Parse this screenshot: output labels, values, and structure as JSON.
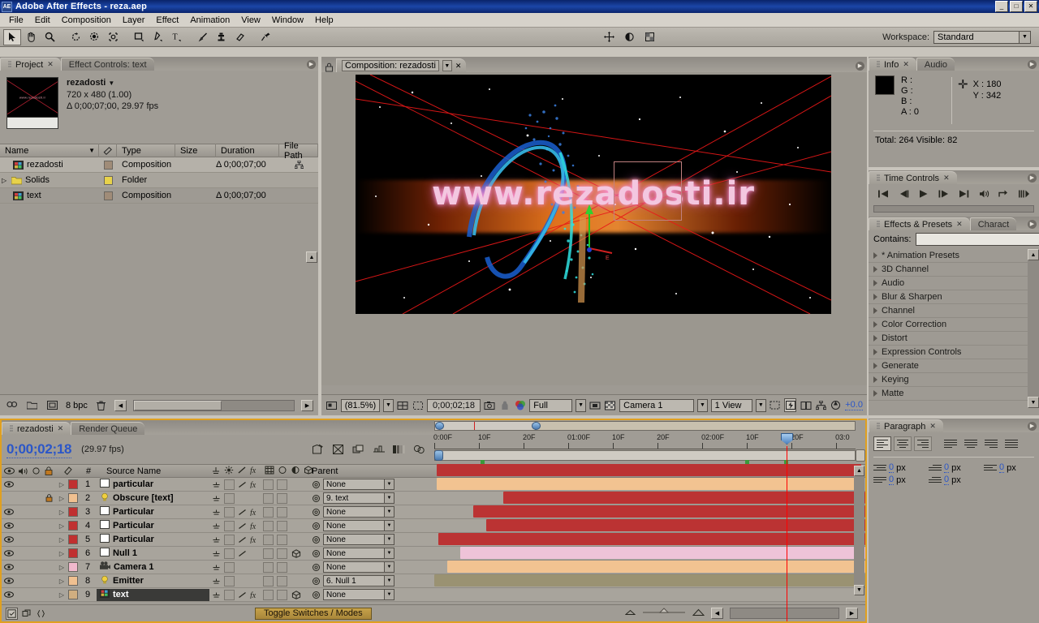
{
  "window": {
    "title": "Adobe After Effects - reza.aep",
    "app_icon": "AE",
    "minimize": "_",
    "maximize": "□",
    "close": "✕"
  },
  "menubar": {
    "items": [
      "File",
      "Edit",
      "Composition",
      "Layer",
      "Effect",
      "Animation",
      "View",
      "Window",
      "Help"
    ]
  },
  "toolbar": {
    "tools": [
      {
        "name": "selection-tool",
        "glyph": "➤",
        "selected": true
      },
      {
        "name": "hand-tool",
        "glyph": "✋",
        "selected": false
      },
      {
        "name": "zoom-tool",
        "glyph": "🔍",
        "selected": false
      },
      {
        "name": "rotation-tool",
        "glyph": "↻",
        "selected": false
      },
      {
        "name": "orbit-camera-tool",
        "glyph": "◕",
        "selected": false
      },
      {
        "name": "pan-behind-tool",
        "glyph": "✣",
        "selected": false
      },
      {
        "name": "shape-tool",
        "glyph": "▭",
        "selected": false
      },
      {
        "name": "pen-tool",
        "glyph": "✒",
        "selected": false
      },
      {
        "name": "type-tool",
        "glyph": "T",
        "selected": false
      },
      {
        "name": "brush-tool",
        "glyph": "🖌",
        "selected": false
      },
      {
        "name": "clone-stamp-tool",
        "glyph": "⚗",
        "selected": false
      },
      {
        "name": "eraser-tool",
        "glyph": "▰",
        "selected": false
      },
      {
        "name": "puppet-pin-tool",
        "glyph": "📌",
        "selected": false
      }
    ],
    "right_icons": [
      {
        "name": "move-anchor-icon",
        "glyph": "✥"
      },
      {
        "name": "mask-opacity-icon",
        "glyph": "◓"
      },
      {
        "name": "toggle-transparency-icon",
        "glyph": "▨"
      }
    ],
    "workspace_label": "Workspace:",
    "workspace_value": "Standard"
  },
  "project": {
    "tabs": [
      {
        "label": "Project",
        "active": true,
        "closable": true
      },
      {
        "label": "Effect Controls: text",
        "active": false,
        "closable": false
      }
    ],
    "selected_item": {
      "name": "rezadosti",
      "dimensions": "720 x 480 (1.00)",
      "duration_fps": "Δ 0;00;07;00, 29.97 fps",
      "thumb_text": "www.rezadosti.ir"
    },
    "columns": [
      "Name",
      "",
      "Type",
      "Size",
      "Duration",
      "File Path"
    ],
    "rows": [
      {
        "name": "rezadosti",
        "icon": "composition-icon",
        "swatch": "#a08c78",
        "type": "Composition",
        "size": "",
        "duration": "Δ 0;00;07;00",
        "selected": true
      },
      {
        "name": "Solids",
        "icon": "folder-icon",
        "swatch": "#e8d24a",
        "type": "Folder",
        "size": "",
        "duration": "",
        "selected": false
      },
      {
        "name": "text",
        "icon": "composition-icon",
        "swatch": "#a08c78",
        "type": "Composition",
        "size": "",
        "duration": "Δ 0;00;07;00",
        "selected": false
      }
    ],
    "footer": {
      "bit_depth": "8 bpc",
      "icons": [
        "search-icon",
        "new-folder-icon",
        "new-composition-icon",
        "delete-icon"
      ]
    }
  },
  "composition": {
    "tab_label": "Composition: rezadosti",
    "comp_text": "www.rezadosti.ir",
    "footer": {
      "magnification": "(81.5%)",
      "current_time": "0;00;02;18",
      "resolution": "Full",
      "view_camera": "Camera 1",
      "view_layout": "1 View",
      "exposure": "+0.0",
      "icons": [
        "always-preview-icon",
        "take-snapshot-icon",
        "show-snapshot-icon",
        "show-channel-icon",
        "region-of-interest-icon",
        "transparency-grid-icon",
        "toggle-mask-icon",
        "timecode-icon",
        "grid-guides-icon",
        "3d-view-icon",
        "pixel-aspect-icon",
        "fast-previews-icon",
        "comp-flowchart-icon",
        "reset-exposure-icon"
      ]
    }
  },
  "info": {
    "tabs": [
      {
        "label": "Info",
        "active": true
      },
      {
        "label": "Audio",
        "active": false
      }
    ],
    "channels": [
      {
        "label": "R :",
        "value": ""
      },
      {
        "label": "G :",
        "value": ""
      },
      {
        "label": "B :",
        "value": ""
      },
      {
        "label": "A :",
        "value": "0"
      }
    ],
    "coords": [
      {
        "label": "X :",
        "value": "180"
      },
      {
        "label": "Y :",
        "value": "342"
      }
    ],
    "status": "Total: 264   Visible: 82",
    "swatch_color": "#000000"
  },
  "time_controls": {
    "tab_label": "Time Controls",
    "buttons": [
      {
        "name": "first-frame-button",
        "glyph": "|◀"
      },
      {
        "name": "previous-frame-button",
        "glyph": "◀|"
      },
      {
        "name": "play-button",
        "glyph": "▶"
      },
      {
        "name": "next-frame-button",
        "glyph": "|▶"
      },
      {
        "name": "last-frame-button",
        "glyph": "▶|"
      },
      {
        "name": "audio-toggle-button",
        "glyph": "🔊"
      },
      {
        "name": "loop-button",
        "glyph": "↻"
      },
      {
        "name": "ram-preview-button",
        "glyph": "⫸"
      }
    ]
  },
  "effects_presets": {
    "tabs": [
      {
        "label": "Effects & Presets",
        "active": true
      },
      {
        "label": "Charact",
        "active": false
      }
    ],
    "contains_label": "Contains:",
    "contains_value": "",
    "items": [
      "* Animation Presets",
      "3D Channel",
      "Audio",
      "Blur & Sharpen",
      "Channel",
      "Color Correction",
      "Distort",
      "Expression Controls",
      "Generate",
      "Keying",
      "Matte"
    ]
  },
  "paragraph": {
    "tab_label": "Paragraph",
    "align_buttons": [
      {
        "name": "align-left-button",
        "selected": true
      },
      {
        "name": "align-center-button",
        "selected": false
      },
      {
        "name": "align-right-button",
        "selected": false
      },
      {
        "name": "justify-last-left-button",
        "selected": false
      },
      {
        "name": "justify-last-center-button",
        "selected": false
      },
      {
        "name": "justify-last-right-button",
        "selected": false
      },
      {
        "name": "justify-all-button",
        "selected": false
      }
    ],
    "fields": [
      {
        "name": "indent-left-field",
        "value": "0",
        "unit": "px"
      },
      {
        "name": "indent-first-line-field",
        "value": "0",
        "unit": "px"
      },
      {
        "name": "indent-right-field",
        "value": "0",
        "unit": "px"
      },
      {
        "name": "space-before-field",
        "value": "0",
        "unit": "px"
      },
      {
        "name": "space-after-field",
        "value": "0",
        "unit": "px"
      }
    ]
  },
  "timeline": {
    "tabs": [
      {
        "label": "rezadosti",
        "active": true,
        "closable": true
      },
      {
        "label": "Render Queue",
        "active": false,
        "closable": false
      }
    ],
    "current_time": "0;00;02;18",
    "fps": "(29.97 fps)",
    "header_icons": [
      "live-update-icon",
      "draft-3d-icon",
      "hide-shy-icon",
      "frame-blending-icon",
      "motion-blur-icon",
      "brainstorm-icon",
      "graph-editor-icon",
      "auto-keyframe-icon"
    ],
    "columns": {
      "video": "eye-icon",
      "audio": "speaker-icon",
      "solo": "solo-icon",
      "lock": "lock-icon",
      "label": "label-icon",
      "number": "#",
      "source_name": "Source Name",
      "switches": [
        "shy-icon",
        "collapse-icon",
        "quality-icon",
        "effects-icon",
        "frame-blend-icon",
        "motion-blur-icon",
        "adjustment-icon",
        "3d-layer-icon"
      ],
      "parent": "Parent"
    },
    "ruler_labels": [
      "0:00F",
      "10F",
      "20F",
      "01:00F",
      "10F",
      "20F",
      "02:00F",
      "10F",
      "20F",
      "03:0"
    ],
    "layers": [
      {
        "num": "1",
        "name": "particular",
        "type": "solid",
        "color": "#c03030",
        "bar_color": "#bb3333",
        "video": true,
        "locked": false,
        "selected": false,
        "parent": "None",
        "start_pct": 0.5,
        "end_pct": 99,
        "icon": "solid-icon",
        "fx": true,
        "motion": true,
        "threeD": false
      },
      {
        "num": "2",
        "name": "Obscure [text]",
        "type": "light",
        "color": "#f0c090",
        "bar_color": "#f2c391",
        "video": false,
        "locked": true,
        "selected": false,
        "parent": "9. text",
        "start_pct": 0.5,
        "end_pct": 99,
        "icon": "light-icon",
        "fx": false,
        "motion": false,
        "threeD": false
      },
      {
        "num": "3",
        "name": "Particular",
        "type": "solid",
        "color": "#c03030",
        "bar_color": "#bb3333",
        "video": true,
        "locked": false,
        "selected": false,
        "parent": "None",
        "start_pct": 16,
        "end_pct": 100,
        "icon": "solid-icon",
        "fx": true,
        "motion": true,
        "threeD": false
      },
      {
        "num": "4",
        "name": "Particular",
        "type": "solid",
        "color": "#c03030",
        "bar_color": "#bb3333",
        "video": true,
        "locked": false,
        "selected": false,
        "parent": "None",
        "start_pct": 9,
        "end_pct": 100,
        "icon": "solid-icon",
        "fx": true,
        "motion": true,
        "threeD": false
      },
      {
        "num": "5",
        "name": "Particular",
        "type": "solid",
        "color": "#c03030",
        "bar_color": "#bb3333",
        "video": true,
        "locked": false,
        "selected": false,
        "parent": "None",
        "start_pct": 12,
        "end_pct": 100,
        "icon": "solid-icon",
        "fx": true,
        "motion": true,
        "threeD": false
      },
      {
        "num": "6",
        "name": "Null 1",
        "type": "solid",
        "color": "#c03030",
        "bar_color": "#bb3333",
        "video": true,
        "locked": false,
        "selected": false,
        "parent": "None",
        "start_pct": 1,
        "end_pct": 100,
        "icon": "solid-icon",
        "fx": false,
        "motion": true,
        "threeD": true
      },
      {
        "num": "7",
        "name": "Camera 1",
        "type": "camera",
        "color": "#f0b8cc",
        "bar_color": "#eec3d8",
        "video": true,
        "locked": false,
        "selected": false,
        "parent": "None",
        "start_pct": 6,
        "end_pct": 100,
        "icon": "camera-icon",
        "fx": false,
        "motion": false,
        "threeD": false
      },
      {
        "num": "8",
        "name": "Emitter",
        "type": "light",
        "color": "#f0c090",
        "bar_color": "#f2c391",
        "video": true,
        "locked": false,
        "selected": false,
        "parent": "6. Null 1",
        "start_pct": 3,
        "end_pct": 100,
        "icon": "light-icon",
        "fx": false,
        "motion": false,
        "threeD": false
      },
      {
        "num": "9",
        "name": "text",
        "type": "comp",
        "color": "#d0ae80",
        "bar_color": "#9a9272",
        "video": true,
        "locked": false,
        "selected": true,
        "parent": "None",
        "start_pct": 0,
        "end_pct": 100,
        "icon": "composition-icon",
        "fx": true,
        "motion": true,
        "threeD": true
      }
    ],
    "footer": {
      "toggle_label": "Toggle Switches / Modes",
      "left_icons": [
        "comp-flowchart-icon",
        "toggle-switches-icon",
        "expand-icon"
      ]
    }
  }
}
